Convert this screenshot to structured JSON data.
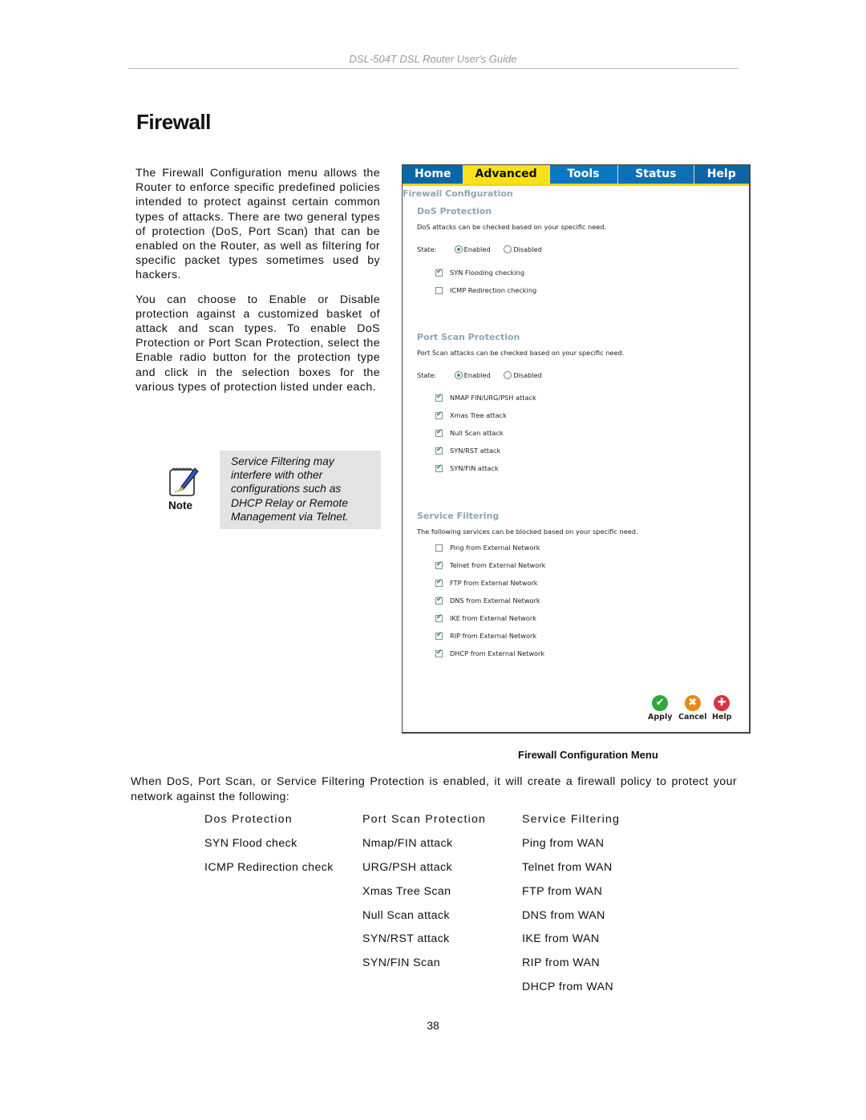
{
  "running_header": "DSL-504T DSL Router User's Guide",
  "page_title": "Firewall",
  "intro_paragraphs": [
    "The Firewall Configuration menu allows the Router to enforce specific predefined policies intended to protect against certain common types of attacks. There are two general types of protection (DoS, Port Scan) that can be enabled on the Router, as well as filtering for specific packet types sometimes used by hackers.",
    "You can choose to Enable or Disable protection against a customized basket of attack and scan types. To enable DoS Protection or Port Scan Protection, select the Enable radio button for the protection type and click in the selection boxes for the various types of protection listed under each."
  ],
  "note": {
    "label": "Note",
    "icon": "notepad-pen-icon",
    "text": "Service Filtering may interfere with other configurations such as DHCP Relay or Remote Management via Telnet."
  },
  "screenshot": {
    "tabs": [
      {
        "label": "Home",
        "active": false
      },
      {
        "label": "Advanced",
        "active": true
      },
      {
        "label": "Tools",
        "active": false
      },
      {
        "label": "Status",
        "active": false
      },
      {
        "label": "Help",
        "active": false
      }
    ],
    "page_heading": "Firewall Configuration",
    "dos": {
      "title": "DoS Protection",
      "description": "DoS attacks can be checked based on your specific need.",
      "state_label": "State:",
      "enabled_label": "Enabled",
      "disabled_label": "Disabled",
      "state": "Enabled",
      "options": [
        {
          "label": "SYN Flooding checking",
          "checked": true
        },
        {
          "label": "ICMP Redirection checking",
          "checked": false
        }
      ]
    },
    "portscan": {
      "title": "Port Scan Protection",
      "description": "Port Scan attacks can be checked based on your specific need.",
      "state_label": "State:",
      "enabled_label": "Enabled",
      "disabled_label": "Disabled",
      "state": "Enabled",
      "options": [
        {
          "label": "NMAP FIN/URG/PSH attack",
          "checked": true
        },
        {
          "label": "Xmas Tree attack",
          "checked": true
        },
        {
          "label": "Null Scan attack",
          "checked": true
        },
        {
          "label": "SYN/RST attack",
          "checked": true
        },
        {
          "label": "SYN/FIN attack",
          "checked": true
        }
      ]
    },
    "service": {
      "title": "Service Filtering",
      "description": "The following services can be blocked based on your specific need.",
      "options": [
        {
          "label": "Ping from External Network",
          "checked": false
        },
        {
          "label": "Telnet from External Network",
          "checked": true
        },
        {
          "label": "FTP from External Network",
          "checked": true
        },
        {
          "label": "DNS from External Network",
          "checked": true
        },
        {
          "label": "IKE from External Network",
          "checked": true
        },
        {
          "label": "RIP from External Network",
          "checked": true
        },
        {
          "label": "DHCP from External Network",
          "checked": true
        }
      ]
    },
    "actions": [
      {
        "label": "Apply",
        "icon": "checkmark-icon",
        "color": "#2fa83a"
      },
      {
        "label": "Cancel",
        "icon": "x-icon",
        "color": "#e8891c"
      },
      {
        "label": "Help",
        "icon": "plus-icon",
        "color": "#d9333b"
      }
    ]
  },
  "caption": "Firewall Configuration Menu",
  "body_paragraph": "When DoS, Port Scan, or Service Filtering Protection is enabled, it will create a firewall policy to protect your network against the following:",
  "policy_table": {
    "headers": [
      "Dos Protection",
      "Port Scan Protection",
      "Service Filtering"
    ],
    "columns": [
      [
        "SYN Flood check",
        "ICMP Redirection check"
      ],
      [
        "Nmap/FIN attack",
        "URG/PSH attack",
        "Xmas Tree Scan",
        "Null Scan attack",
        "SYN/RST attack",
        "SYN/FIN Scan"
      ],
      [
        "Ping from WAN",
        "Telnet from WAN",
        "FTP from WAN",
        "DNS from WAN",
        "IKE from WAN",
        "RIP from WAN",
        "DHCP from WAN"
      ]
    ]
  },
  "page_number": "38"
}
